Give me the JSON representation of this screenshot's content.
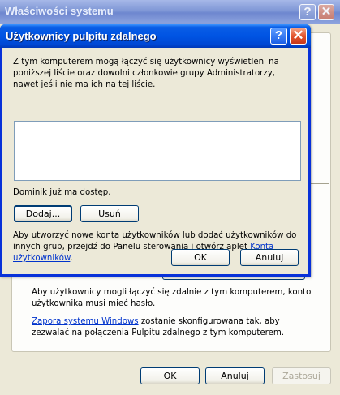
{
  "system_properties": {
    "title": "Właściwości systemu",
    "help_glyph": "?",
    "close_glyph": "✕",
    "remote_text": "Aby użytkownicy mogli łączyć się zdalnie z tym komputerem, konto użytkownika musi mieć hasło.",
    "firewall_link": "Zapora systemu Windows",
    "firewall_text": " zostanie skonfigurowana tak, aby zezwalać na połączenia Pulpitu zdalnego z tym komputerem.",
    "ok_label": "OK",
    "cancel_label": "Anuluj",
    "apply_label": "Zastosuj"
  },
  "dialog": {
    "title": "Użytkownicy pulpitu zdalnego",
    "help_glyph": "?",
    "close_glyph": "✕",
    "intro_text": "Z tym komputerem mogą łączyć się użytkownicy wyświetleni na poniższej liście oraz dowolni członkowie grupy Administratorzy, nawet jeśli nie ma ich na tej liście.",
    "users": [],
    "access_text": "Dominik już ma dostęp.",
    "add_label": "Dodaj...",
    "remove_label": "Usuń",
    "info_text": "Aby utworzyć nowe konta użytkowników lub dodać użytkowników do innych grup, przejdź do Panelu sterowania i otwórz aplet ",
    "accounts_link": "Konta użytkowników",
    "info_period": ".",
    "ok_label": "OK",
    "cancel_label": "Anuluj"
  }
}
